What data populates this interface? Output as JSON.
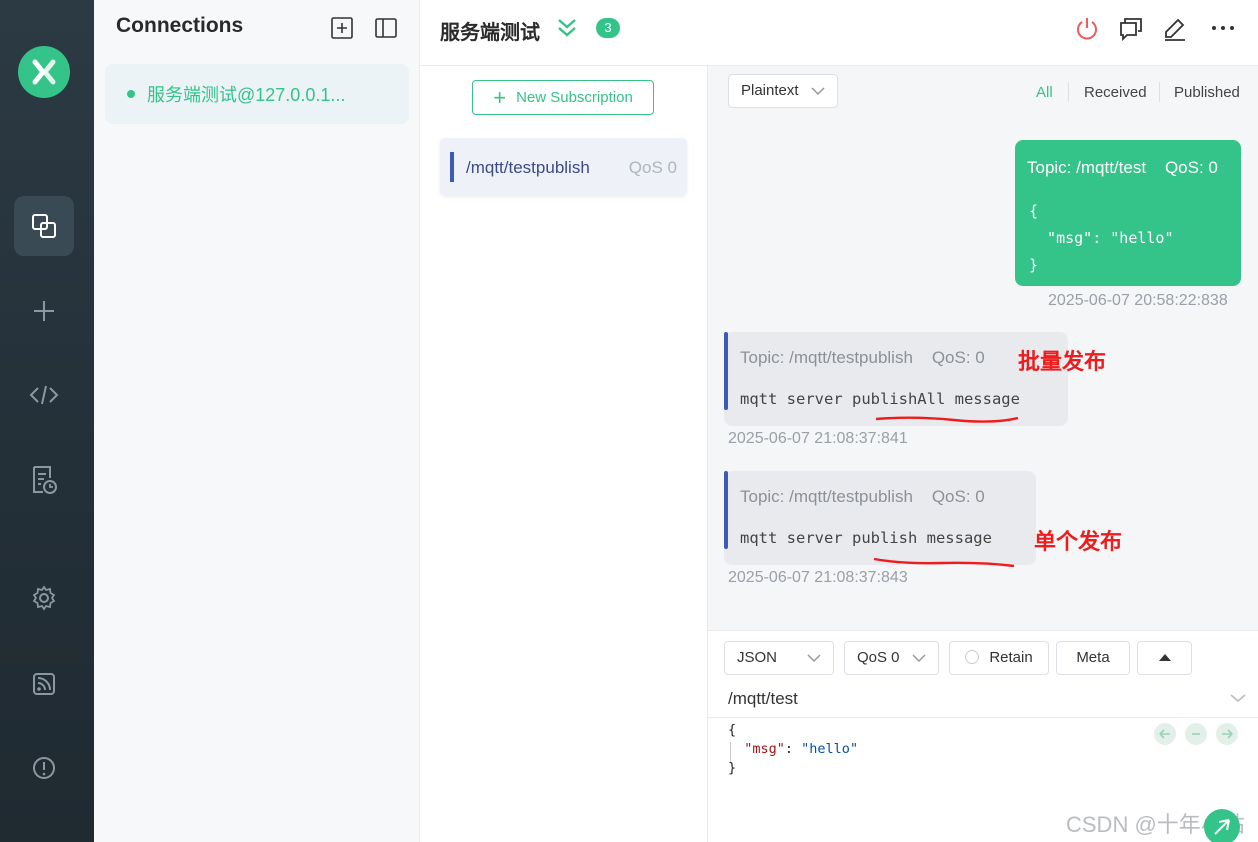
{
  "app": {
    "accent_color": "#34c388",
    "topic_bar_color": "#3b5bb5",
    "annotation_color": "#ee1c1c",
    "logo_icon": "mqttx-logo-icon"
  },
  "nav": {
    "items": [
      {
        "icon": "connections-icon",
        "active": true
      },
      {
        "icon": "plus-icon"
      },
      {
        "icon": "code-icon"
      },
      {
        "icon": "log-icon"
      },
      {
        "icon": "gear-icon"
      },
      {
        "icon": "feed-icon"
      },
      {
        "icon": "info-icon"
      }
    ]
  },
  "connections": {
    "title": "Connections",
    "items": [
      {
        "name": "服务端测试@127.0.0.1...",
        "status": "connected"
      }
    ]
  },
  "header": {
    "title": "服务端测试",
    "badge": "3",
    "icons": [
      "power-icon",
      "chat-icon",
      "edit-icon",
      "more-icon"
    ]
  },
  "subscriptions": {
    "new_label": "New Subscription",
    "items": [
      {
        "topic": "/mqtt/testpublish",
        "qos": "QoS 0"
      }
    ]
  },
  "messages": {
    "format": "Plaintext",
    "filters": [
      "All",
      "Received",
      "Published"
    ],
    "active_filter": "All",
    "list": [
      {
        "direction": "published",
        "topic": "Topic: /mqtt/test",
        "qos": "QoS: 0",
        "payload_lines": [
          "{",
          "  \"msg\": \"hello\"",
          "}"
        ],
        "time": "2025-06-07 20:58:22:838"
      },
      {
        "direction": "received",
        "topic": "Topic: /mqtt/testpublish",
        "qos": "QoS: 0",
        "payload": "mqtt server publishAll message",
        "time": "2025-06-07 21:08:37:841",
        "annotation": "批量发布"
      },
      {
        "direction": "received",
        "topic": "Topic: /mqtt/testpublish",
        "qos": "QoS: 0",
        "payload": "mqtt server publish message",
        "time": "2025-06-07 21:08:37:843",
        "annotation": "单个发布"
      }
    ]
  },
  "composer": {
    "format": "JSON",
    "qos": "QoS 0",
    "retain_label": "Retain",
    "meta_label": "Meta",
    "topic": "/mqtt/test",
    "payload": {
      "open": "{",
      "key": "\"msg\"",
      "colon": ": ",
      "value": "\"hello\"",
      "close": "}"
    }
  },
  "watermark": "CSDN @十年小站"
}
